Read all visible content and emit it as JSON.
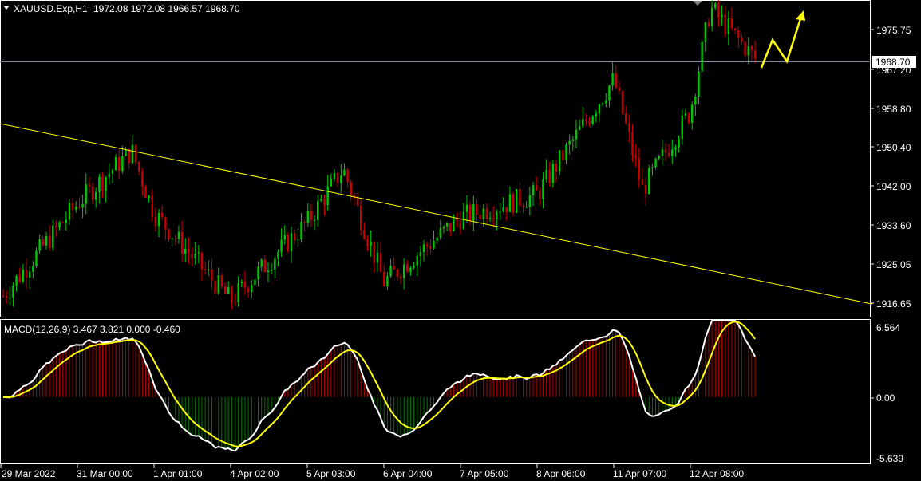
{
  "symbol_info": {
    "symbol": "XAUUSD.Exp,H1",
    "ohlc": "1972.08 1972.08 1966.57 1968.70"
  },
  "current_price_label": "1968.70",
  "price_axis": [
    "1975.75",
    "1967.20",
    "1958.80",
    "1950.40",
    "1942.00",
    "1933.60",
    "1925.05",
    "1916.65"
  ],
  "indicator": {
    "label": "MACD(12,26,9) 3.467 3.821 0.000 -0.460",
    "axis": [
      "6.564",
      "0.00",
      "-5.639"
    ]
  },
  "time_axis": [
    "29 Mar 2022",
    "31 Mar 00:00",
    "1 Apr 01:00",
    "4 Apr 02:00",
    "5 Apr 03:00",
    "6 Apr 04:00",
    "7 Apr 05:00",
    "8 Apr 06:00",
    "11 Apr 07:00",
    "12 Apr 08:00"
  ],
  "colors": {
    "background": "#000000",
    "bull": "#00c800",
    "bear": "#c80000",
    "trendline": "#ffff00",
    "forecast_arrow": "#ffff00",
    "macd_line": "#ffffff",
    "signal_line": "#ffff00",
    "hist_pos": "#b40000",
    "hist_neg": "#007800",
    "grid": "#ffffff"
  },
  "chart_data": {
    "type": "candlestick",
    "timeframe": "H1",
    "price_range": [
      1913.5,
      1982.0
    ],
    "trendline": {
      "from": [
        "29 Mar 2022",
        1954.5
      ],
      "to": [
        "13 Apr",
        1916.0
      ]
    },
    "key_prices": [
      {
        "label": "29 Mar 2022",
        "close": 1918
      },
      {
        "label": "31 Mar 00:00",
        "close": 1938
      },
      {
        "label": "31 Mar high",
        "high": 1949.5
      },
      {
        "label": "1 Apr 01:00",
        "close": 1936
      },
      {
        "label": "4 Apr 02:00",
        "close": 1917
      },
      {
        "label": "5 Apr 03:00",
        "close": 1934
      },
      {
        "label": "5 Apr high",
        "high": 1945.5
      },
      {
        "label": "6 Apr 04:00",
        "close": 1921
      },
      {
        "label": "7 Apr 05:00",
        "close": 1935
      },
      {
        "label": "8 Apr 06:00",
        "close": 1940
      },
      {
        "label": "11 Apr 07:00",
        "close": 1965
      },
      {
        "label": "11 Apr low",
        "low": 1941
      },
      {
        "label": "12 Apr 08:00",
        "close": 1958
      },
      {
        "label": "12 Apr high",
        "high": 1980.5
      },
      {
        "label": "last",
        "close": 1968.7
      }
    ],
    "macd_range": [
      -5.639,
      6.564
    ],
    "macd_last": {
      "macd": 3.467,
      "signal": 3.821,
      "hist": -0.46
    }
  }
}
